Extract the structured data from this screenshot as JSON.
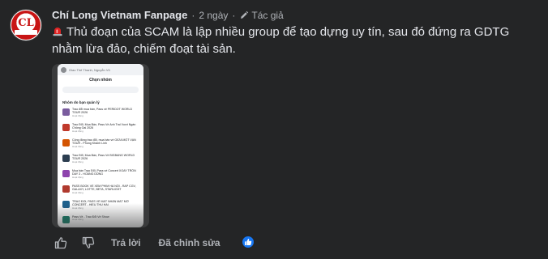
{
  "comment": {
    "author": "Chí Long Vietnam Fanpage",
    "separator": "·",
    "time": "2 ngày",
    "author_badge": "Tác giả",
    "text": "Thủ đoạn của SCAM là lập nhiều group để tạo dựng uy tín, sau đó đứng ra GDTG nhằm lừa đảo, chiếm đoạt tài sản.",
    "siren_icon": "police-siren-icon",
    "avatar_logo": "chi-long-logo"
  },
  "attachment": {
    "phone_header": "Giao Thế Thanh, Nguyễn Vũ",
    "title": "Chọn nhóm",
    "section_label": "Nhóm do bạn quản lý",
    "groups": [
      {
        "name": "Trao đổi mua bán, Pass vé PERIDOT WORLD TOUR 2026",
        "sub": "Hoạt động",
        "color": "#7a5c9e"
      },
      {
        "name": "Trao Đổi, Mua Bán, Pass Vé Anh Trai Vượt Ngàn Chông Gai 2026",
        "sub": "Hoạt động",
        "color": "#c0392b"
      },
      {
        "name": "Cộng đồng trao đổi, mua bán vé GIỮA MỘT VẠN TOUR - Phùng Khánh Linh",
        "sub": "Hoạt động",
        "color": "#d35400"
      },
      {
        "name": "Trao Đổi, Mua Bán, Pass Vé BIGBANG WORLD TOUR 2026",
        "sub": "Hoạt động",
        "color": "#2c3e50"
      },
      {
        "name": "Mua bán Trao Đổi, Pass vé Concert XOAY TRÒN DAY 3 - HOÀNG DŨNG",
        "sub": "Hoạt động",
        "color": "#8e44ad"
      },
      {
        "name": "PASS BOOK VÉ XEM PHIM HÀ NỘI - RAP CGV, GALAXY, LOTTE, BETA, STARLIGHT",
        "sub": "Hoạt động",
        "color": "#b03a2e"
      },
      {
        "name": "TRAO ĐỔI, PASS VÉ MẤT NHÂN MẤT MỞ CONCERT - HIEU THU HAI",
        "sub": "Hoạt động",
        "color": "#1f618d"
      },
      {
        "name": "Pass Vé - Trao Đổi Vé Show",
        "sub": "Hoạt động",
        "color": "#117a65"
      }
    ]
  },
  "actions": {
    "like_icon": "thumbs-up-outline-icon",
    "dislike_icon": "thumbs-down-outline-icon",
    "reply_label": "Trả lời",
    "edited_label": "Đã chỉnh sửa",
    "reaction_icon": "like-reaction-icon"
  },
  "colors": {
    "background": "#242526",
    "primary_text": "#e4e6eb",
    "secondary_text": "#b0b3b8",
    "like_blue": "#1877f2",
    "siren_red": "#e02424"
  }
}
